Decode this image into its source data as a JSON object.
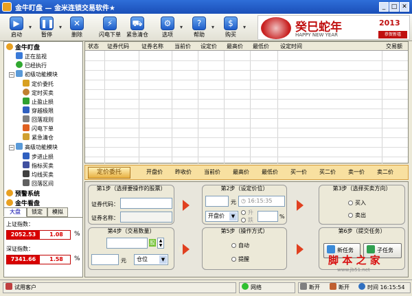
{
  "app": {
    "title": "金牛盯盘  — 金米连锁交易软件★"
  },
  "toolbar": {
    "buttons": [
      {
        "label": "启动",
        "icon": "play-icon"
      },
      {
        "label": "暂停",
        "icon": "pause-icon"
      },
      {
        "label": "删除",
        "icon": "delete-icon"
      },
      {
        "label": "闪电下单",
        "icon": "lightning-icon"
      },
      {
        "label": "紧急清仓",
        "icon": "cart-icon"
      },
      {
        "label": "选项",
        "icon": "options-icon"
      },
      {
        "label": "帮助",
        "icon": "help-icon"
      },
      {
        "label": "购买",
        "icon": "purchase-icon"
      }
    ],
    "sep": "▾"
  },
  "banner": {
    "title": "癸巳蛇年",
    "year": "2013",
    "sub": "HAPPY NEW YEAR",
    "stamp": "恭贺新禧"
  },
  "tree": {
    "root1": "金牛盯盘",
    "monitor": "正在监视",
    "executed": "已经执行",
    "basic": "初级功能模块",
    "basic_items": [
      "定价委托",
      "定时买卖",
      "止盈止损",
      "穿越极限",
      "回落观则",
      "闪电下单",
      "紧急清仓"
    ],
    "advanced": "高级功能模块",
    "adv_items": [
      "步进止损",
      "指标买卖",
      "均线买卖",
      "回落区间"
    ],
    "root2": "预警系统",
    "root3": "金牛看盘"
  },
  "index": {
    "tabs": [
      "大盘",
      "锁定",
      "模拟"
    ],
    "sh_label": "上证指数：",
    "sh_value": "2052.53",
    "sh_change": "1.08",
    "sz_label": "深证指数：",
    "sz_value": "7341.66",
    "sz_change": "1.58",
    "pct": "%"
  },
  "grid": {
    "columns": [
      "状态",
      "证券代码",
      "证券名称",
      "当前价",
      "设定价",
      "最高价",
      "最低价",
      "设定时间",
      "交易额"
    ]
  },
  "quote": {
    "button": "定价委托",
    "labels": [
      "开盘价",
      "昨收价",
      "当前价",
      "最高价",
      "最低价",
      "买一价",
      "买二价",
      "卖一价",
      "卖二价"
    ]
  },
  "step1": {
    "title": "第1步（选择要操作的股票）",
    "code_label": "证券代码：",
    "name_label": "证券名称："
  },
  "step2": {
    "title": "第2步（设定价位）",
    "unit": "元",
    "time": "16:15:35",
    "up": "升",
    "down": "跌",
    "price_sel": "开盘价",
    "pct": "%"
  },
  "step3": {
    "title": "第3步（选择买卖方向）",
    "buy": "买入",
    "sell": "卖出"
  },
  "step4": {
    "title": "第4步（交易数量）",
    "unit_share": "股",
    "unit_yuan": "元",
    "pos_sel": "仓位"
  },
  "step5": {
    "title": "第5步（操作方式）",
    "auto": "自动",
    "remind": "提醒"
  },
  "step6": {
    "title": "第6步（提交任务）",
    "new_task": "新任务",
    "sub_task": "子任务"
  },
  "status": {
    "user": "试用客户",
    "network": "网络",
    "disconnect": "断开",
    "toggle": "断开",
    "time_label": "时间",
    "time": "16:15:54"
  },
  "watermark": {
    "main": "脚 本 之 家",
    "sub": "www.jb51.net"
  },
  "colors": {
    "index_red": "#d80000",
    "title_blue": "#1a4fb8",
    "arrow_red": "#e04020"
  }
}
